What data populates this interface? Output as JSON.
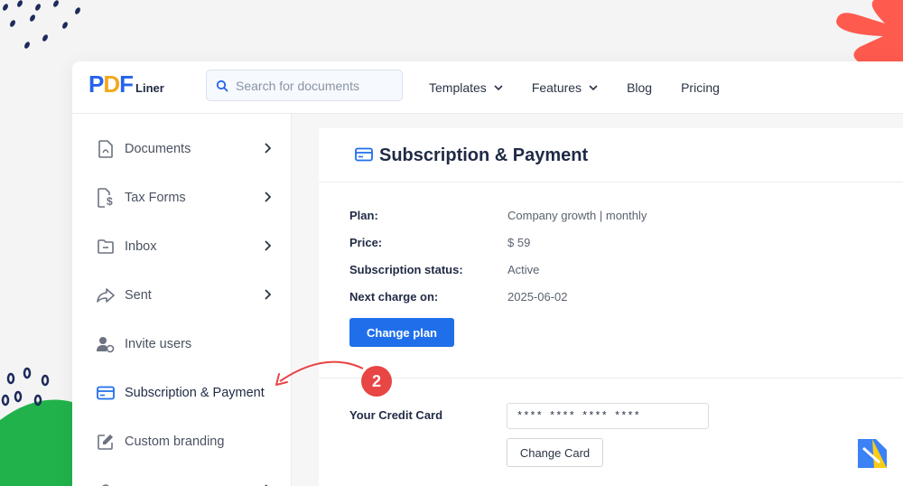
{
  "app": {
    "logo": {
      "p": "P",
      "d": "D",
      "f": "F",
      "liner": "Liner"
    },
    "search": {
      "placeholder": "Search for documents",
      "value": ""
    },
    "nav": [
      {
        "label": "Templates",
        "has_dropdown": true
      },
      {
        "label": "Features",
        "has_dropdown": true
      },
      {
        "label": "Blog",
        "has_dropdown": false
      },
      {
        "label": "Pricing",
        "has_dropdown": false
      }
    ]
  },
  "sidebar": {
    "items": [
      {
        "label": "Documents",
        "icon": "document-icon",
        "has_arrow": true
      },
      {
        "label": "Tax Forms",
        "icon": "tax-forms-icon",
        "has_arrow": true
      },
      {
        "label": "Inbox",
        "icon": "inbox-folder-icon",
        "has_arrow": true
      },
      {
        "label": "Sent",
        "icon": "share-arrow-icon",
        "has_arrow": true
      },
      {
        "label": "Invite users",
        "icon": "user-gear-icon",
        "has_arrow": false
      },
      {
        "label": "Subscription & Payment",
        "icon": "credit-card-icon",
        "has_arrow": false,
        "active": true
      },
      {
        "label": "Custom branding",
        "icon": "edit-icon",
        "has_arrow": false
      }
    ]
  },
  "subscription": {
    "title": "Subscription & Payment",
    "fields": [
      {
        "key": "Plan:",
        "value": "Company growth | monthly"
      },
      {
        "key": "Price:",
        "value": "$ 59"
      },
      {
        "key": "Subscription status:",
        "value": "Active"
      },
      {
        "key": "Next charge on:",
        "value": "2025-06-02"
      }
    ],
    "change_plan_label": "Change plan",
    "credit_card_label": "Your Credit Card",
    "credit_card_value": "**** **** **** ****",
    "change_card_label": "Change Card"
  },
  "annotation": {
    "step_number": "2"
  },
  "colors": {
    "primary": "#1f6feb",
    "accent_red": "#e84545",
    "logo_yellow": "#f2a81d",
    "deco_green": "#22b24c",
    "deco_coral": "#ff5a4e",
    "deco_navy": "#1e2a5a"
  }
}
